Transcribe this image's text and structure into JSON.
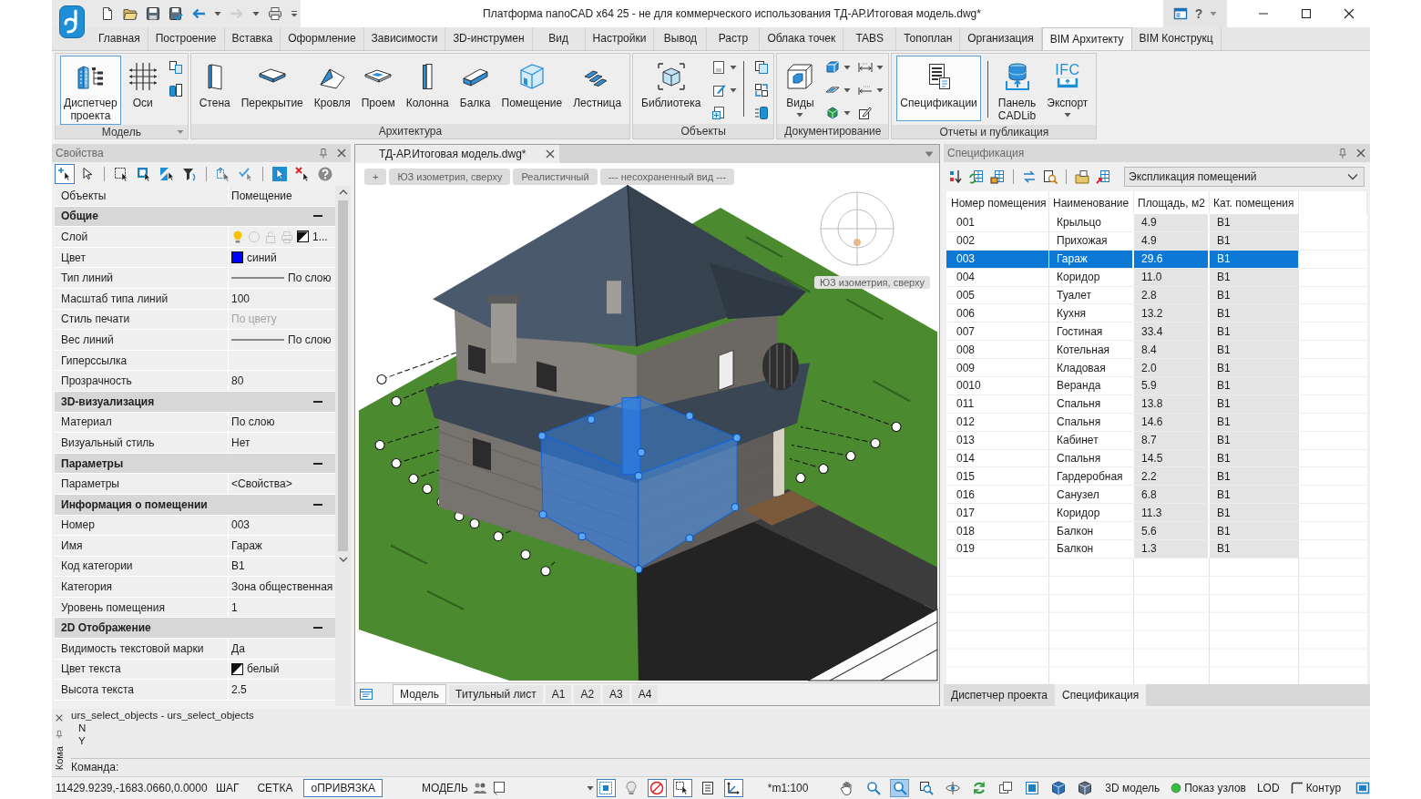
{
  "title_bar": {
    "title": "Платформа nanoCAD x64 25 - не для коммерческого использования ТД-АР.Итоговая модель.dwg*",
    "help": "?"
  },
  "ribbon": {
    "tabs": [
      {
        "label": "Главная",
        "selected": false
      },
      {
        "label": "Построение",
        "selected": false
      },
      {
        "label": "Вставка",
        "selected": false
      },
      {
        "label": "Оформление",
        "selected": false
      },
      {
        "label": "Зависимости",
        "selected": false
      },
      {
        "label": "3D-инструмен",
        "selected": false
      },
      {
        "label": "Вид",
        "selected": false
      },
      {
        "label": "Настройки",
        "selected": false
      },
      {
        "label": "Вывод",
        "selected": false
      },
      {
        "label": "Растр",
        "selected": false
      },
      {
        "label": "Облака точек",
        "selected": false
      },
      {
        "label": "TABS",
        "selected": false
      },
      {
        "label": "Топоплан",
        "selected": false
      },
      {
        "label": "Организация",
        "selected": false
      },
      {
        "label": "BIM Архитекту",
        "selected": true
      },
      {
        "label": "BIM Конструкц",
        "selected": false
      }
    ],
    "groups": [
      {
        "title": "Модель",
        "launcher": true,
        "buttons": [
          {
            "label": "Диспетчер проекта",
            "selected": true,
            "dropdown": false
          },
          {
            "label": "Оси",
            "selected": false,
            "dropdown": false
          }
        ]
      },
      {
        "title": "Архитектура",
        "launcher": false,
        "buttons": [
          {
            "label": "Стена",
            "selected": false,
            "dropdown": false
          },
          {
            "label": "Перекрытие",
            "selected": false,
            "dropdown": false
          },
          {
            "label": "Кровля",
            "selected": false,
            "dropdown": false
          },
          {
            "label": "Проем",
            "selected": false,
            "dropdown": false
          },
          {
            "label": "Колонна",
            "selected": false,
            "dropdown": false
          },
          {
            "label": "Балка",
            "selected": false,
            "dropdown": false
          },
          {
            "label": "Помещение",
            "selected": false,
            "dropdown": false
          },
          {
            "label": "Лестница",
            "selected": false,
            "dropdown": false
          }
        ]
      },
      {
        "title": "Объекты",
        "launcher": false,
        "buttons": [
          {
            "label": "Библиотека",
            "selected": false,
            "dropdown": false
          }
        ]
      },
      {
        "title": "Документирование",
        "launcher": false,
        "buttons": [
          {
            "label": "Виды",
            "selected": false,
            "dropdown": true
          }
        ]
      },
      {
        "title": "Отчеты и публикация",
        "launcher": false,
        "buttons": [
          {
            "label": "Спецификации",
            "selected": true,
            "dropdown": false
          },
          {
            "label": "Панель CADLib",
            "selected": false,
            "dropdown": false
          },
          {
            "label": "Экспорт",
            "selected": false,
            "dropdown": true,
            "icon_text": "IFC"
          }
        ]
      }
    ]
  },
  "properties_panel": {
    "title": "Свойства",
    "toolbar": [
      {
        "on": true
      },
      {
        "on": false
      },
      {
        "on": false
      },
      {
        "on": false
      },
      {
        "on": false
      },
      {
        "on": false
      },
      {
        "on": false
      },
      {
        "on": false
      },
      {
        "on": false
      },
      {
        "on": false
      },
      {
        "on": false
      }
    ],
    "rows": [
      {
        "kind": "text",
        "label": "Объекты",
        "value": "Помещение",
        "disabled": false
      },
      {
        "kind": "section",
        "label": "Общие",
        "expanded": true
      },
      {
        "kind": "layer",
        "label": "Слой",
        "value": "1...",
        "color": "#ffffff",
        "layer_state": {
          "on": true,
          "frozen": false,
          "locked": false
        },
        "disabled": false
      },
      {
        "kind": "swatch",
        "label": "Цвет",
        "value": "синий",
        "color": "#0000ff",
        "disabled": false
      },
      {
        "kind": "line",
        "label": "Тип линий",
        "value": "По слою",
        "disabled": false
      },
      {
        "kind": "text",
        "label": "Масштаб типа линий",
        "value": "100",
        "disabled": false
      },
      {
        "kind": "text",
        "label": "Стиль печати",
        "value": "По цвету",
        "disabled": true
      },
      {
        "kind": "line",
        "label": "Вес линий",
        "value": "По слою",
        "disabled": false
      },
      {
        "kind": "text",
        "label": "Гиперссылка"
      },
      {
        "kind": "text",
        "label": "Прозрачность",
        "value": "80",
        "disabled": false
      },
      {
        "kind": "section",
        "label": "3D-визуализация",
        "expanded": true
      },
      {
        "kind": "text",
        "label": "Материал",
        "value": "По слою",
        "disabled": false
      },
      {
        "kind": "text",
        "label": "Визуальный стиль",
        "value": "Нет",
        "disabled": false
      },
      {
        "kind": "section",
        "label": "Параметры",
        "expanded": true
      },
      {
        "kind": "text",
        "label": "Параметры",
        "value": "<Свойства>",
        "disabled": false
      },
      {
        "kind": "section",
        "label": "Информация о помещении",
        "expanded": true
      },
      {
        "kind": "text",
        "label": "Номер",
        "value": "003",
        "disabled": false
      },
      {
        "kind": "text",
        "label": "Имя",
        "value": "Гараж",
        "disabled": false
      },
      {
        "kind": "text",
        "label": "Код категории",
        "value": "B1",
        "disabled": false
      },
      {
        "kind": "text",
        "label": "Категория",
        "value": "Зона общественная",
        "disabled": false
      },
      {
        "kind": "text",
        "label": "Уровень помещения",
        "value": "1",
        "disabled": false
      },
      {
        "kind": "section",
        "label": "2D Отображение",
        "expanded": true
      },
      {
        "kind": "text",
        "label": "Видимость текстовой марки",
        "value": "Да",
        "disabled": false
      },
      {
        "kind": "swatch",
        "label": "Цвет текста",
        "value": "белый",
        "color": "#ffffff",
        "disabled": false
      },
      {
        "kind": "text",
        "label": "Высота текста",
        "value": "2.5",
        "disabled": false
      }
    ]
  },
  "viewport": {
    "document_tab": "ТД-АР.Итоговая модель.dwg*",
    "view_controls": [
      "+",
      "ЮЗ изометрия, сверху",
      "Реалистичный",
      "--- несохраненный вид ---"
    ],
    "view_name": "ЮЗ изометрия, сверху",
    "layout_tabs": [
      {
        "label": "Модель",
        "selected": true
      },
      {
        "label": "Титульный лист",
        "selected": false
      },
      {
        "label": "A1",
        "selected": false
      },
      {
        "label": "A2",
        "selected": false
      },
      {
        "label": "A3",
        "selected": false
      },
      {
        "label": "A4",
        "selected": false
      }
    ]
  },
  "specification_panel": {
    "title": "Спецификация",
    "selector": "Экспликация помещений",
    "table": {
      "columns": [
        "Номер помещения",
        "Наименование",
        "Площадь, м2",
        "Кат. помещения"
      ],
      "rows": [
        {
          "cells": [
            "001",
            "Крыльцо",
            "4.9",
            "B1"
          ],
          "selected": false
        },
        {
          "cells": [
            "002",
            "Прихожая",
            "4.9",
            "B1"
          ],
          "selected": false
        },
        {
          "cells": [
            "003",
            "Гараж",
            "29.6",
            "B1"
          ],
          "selected": true
        },
        {
          "cells": [
            "004",
            "Коридор",
            "11.0",
            "B1"
          ],
          "selected": false
        },
        {
          "cells": [
            "005",
            "Туалет",
            "2.8",
            "B1"
          ],
          "selected": false
        },
        {
          "cells": [
            "006",
            "Кухня",
            "13.2",
            "B1"
          ],
          "selected": false
        },
        {
          "cells": [
            "007",
            "Гостиная",
            "33.4",
            "B1"
          ],
          "selected": false
        },
        {
          "cells": [
            "008",
            "Котельная",
            "8.4",
            "B1"
          ],
          "selected": false
        },
        {
          "cells": [
            "009",
            "Кладовая",
            "2.0",
            "B1"
          ],
          "selected": false
        },
        {
          "cells": [
            "0010",
            "Веранда",
            "5.9",
            "B1"
          ],
          "selected": false
        },
        {
          "cells": [
            "011",
            "Спальня",
            "13.8",
            "B1"
          ],
          "selected": false
        },
        {
          "cells": [
            "012",
            "Спальня",
            "14.6",
            "B1"
          ],
          "selected": false
        },
        {
          "cells": [
            "013",
            "Кабинет",
            "8.7",
            "B1"
          ],
          "selected": false
        },
        {
          "cells": [
            "014",
            "Спальня",
            "14.5",
            "B1"
          ],
          "selected": false
        },
        {
          "cells": [
            "015",
            "Гардеробная",
            "2.2",
            "B1"
          ],
          "selected": false
        },
        {
          "cells": [
            "016",
            "Санузел",
            "6.8",
            "B1"
          ],
          "selected": false
        },
        {
          "cells": [
            "017",
            "Коридор",
            "11.3",
            "B1"
          ],
          "selected": false
        },
        {
          "cells": [
            "018",
            "Балкон",
            "5.6",
            "B1"
          ],
          "selected": false
        },
        {
          "cells": [
            "019",
            "Балкон",
            "1.3",
            "B1"
          ],
          "selected": false
        }
      ]
    },
    "tabs": [
      {
        "label": "Диспетчер проекта",
        "selected": false
      },
      {
        "label": "Спецификация",
        "selected": true
      }
    ]
  },
  "command_line": {
    "dock_label": "Кома",
    "history": [
      "urs_select_objects - urs_select_objects",
      "N",
      "Y"
    ],
    "prompt": "Команда:"
  },
  "status_bar": {
    "coordinates": "11429.9239,-1683.0660,0.0000",
    "modes": [
      {
        "label": "ШАГ",
        "on": false
      },
      {
        "label": "СЕТКА",
        "on": false
      },
      {
        "label": "оПРИВЯЗКА",
        "on": true
      }
    ],
    "space": "МОДЕЛЬ",
    "drafting_tools": [
      {
        "on": true
      },
      {
        "on": false
      },
      {
        "on": true
      },
      {
        "on": true
      },
      {
        "on": false
      },
      {
        "on": true
      }
    ],
    "scale": "*m1:100",
    "view_tools": [
      {
        "on": false
      },
      {
        "on": false
      },
      {
        "on": true
      },
      {
        "on": false
      },
      {
        "on": false
      },
      {
        "on": false
      },
      {
        "on": false
      },
      {
        "on": false
      },
      {
        "on": false
      },
      {
        "on": false
      }
    ],
    "model_3d": "3D модель",
    "show_nodes": {
      "label": "Показ узлов",
      "on": true
    },
    "lod": "LOD",
    "contour": "Контур"
  }
}
